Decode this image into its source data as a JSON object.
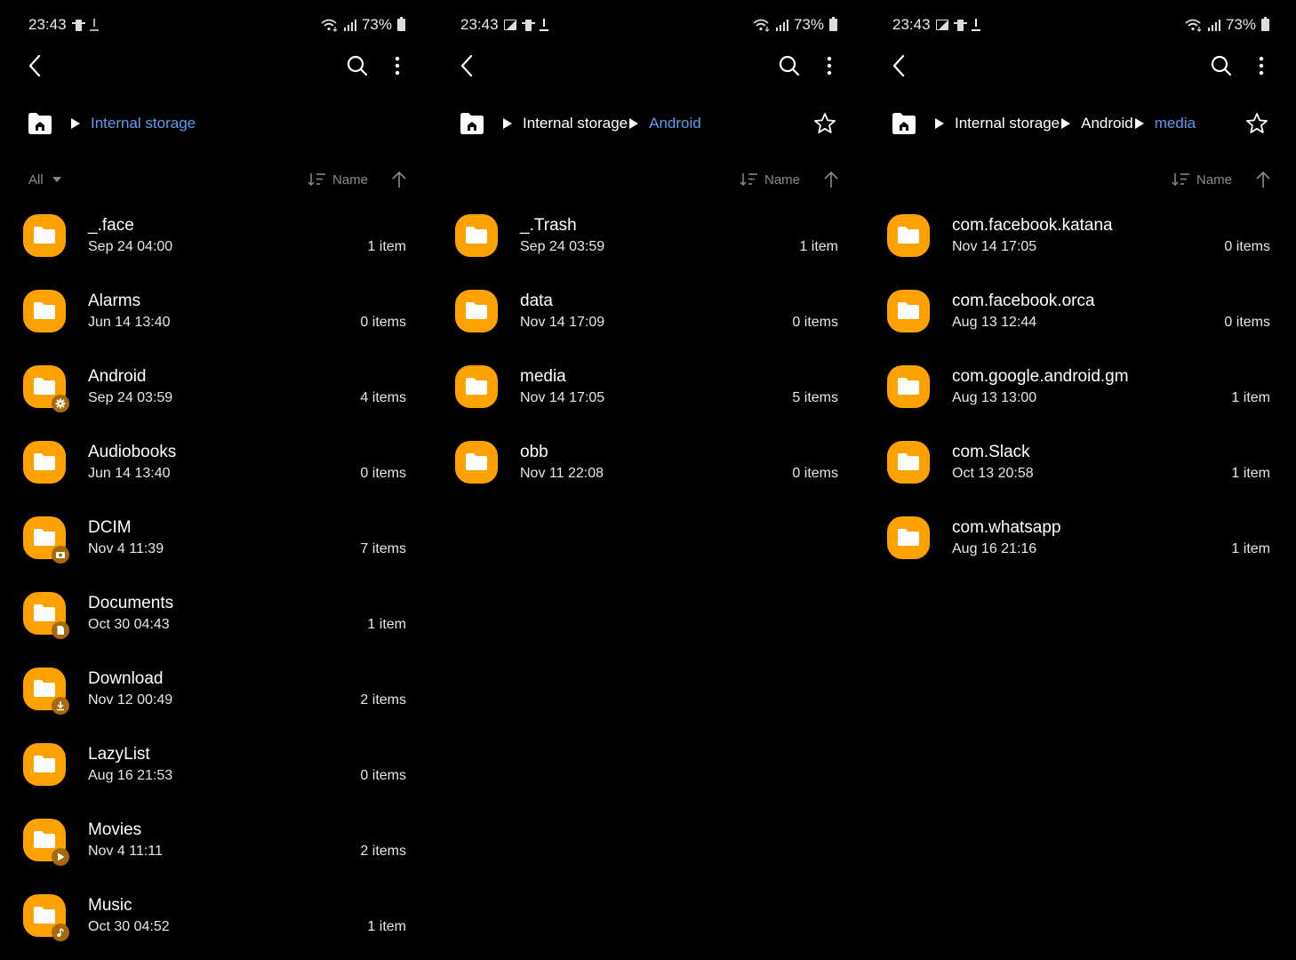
{
  "colors": {
    "accent": "#5e9cf0",
    "folder": "#ffa200",
    "badge": "#a8680c",
    "background": "#000000"
  },
  "panels": [
    {
      "status": {
        "time": "23:43",
        "icons_left": [
          "phone-mirror-icon",
          "download-icon"
        ],
        "battery": "73%"
      },
      "breadcrumb": [
        {
          "label": "Internal storage",
          "active": true
        }
      ],
      "has_star": false,
      "filter": {
        "label": "All"
      },
      "sort": {
        "label": "Name",
        "direction": "ascending"
      },
      "items": [
        {
          "name": "_.face",
          "date": "Sep 24 04:00",
          "count": "1 item",
          "badge": ""
        },
        {
          "name": "Alarms",
          "date": "Jun 14 13:40",
          "count": "0 items",
          "badge": ""
        },
        {
          "name": "Android",
          "date": "Sep 24 03:59",
          "count": "4 items",
          "badge": "gear"
        },
        {
          "name": "Audiobooks",
          "date": "Jun 14 13:40",
          "count": "0 items",
          "badge": ""
        },
        {
          "name": "DCIM",
          "date": "Nov 4 11:39",
          "count": "7 items",
          "badge": "camera"
        },
        {
          "name": "Documents",
          "date": "Oct 30 04:43",
          "count": "1 item",
          "badge": "document"
        },
        {
          "name": "Download",
          "date": "Nov 12 00:49",
          "count": "2 items",
          "badge": "download"
        },
        {
          "name": "LazyList",
          "date": "Aug 16 21:53",
          "count": "0 items",
          "badge": ""
        },
        {
          "name": "Movies",
          "date": "Nov 4 11:11",
          "count": "2 items",
          "badge": "play"
        },
        {
          "name": "Music",
          "date": "Oct 30 04:52",
          "count": "1 item",
          "badge": "music"
        }
      ]
    },
    {
      "status": {
        "time": "23:43",
        "icons_left": [
          "gallery-icon",
          "phone-mirror-icon",
          "download-icon"
        ],
        "battery": "73%"
      },
      "breadcrumb": [
        {
          "label": "Internal storage",
          "active": false
        },
        {
          "label": "Android",
          "active": true
        }
      ],
      "has_star": true,
      "filter": null,
      "sort": {
        "label": "Name",
        "direction": "ascending"
      },
      "items": [
        {
          "name": "_.Trash",
          "date": "Sep 24 03:59",
          "count": "1 item",
          "badge": ""
        },
        {
          "name": "data",
          "date": "Nov 14 17:09",
          "count": "0 items",
          "badge": ""
        },
        {
          "name": "media",
          "date": "Nov 14 17:05",
          "count": "5 items",
          "badge": ""
        },
        {
          "name": "obb",
          "date": "Nov 11 22:08",
          "count": "0 items",
          "badge": ""
        }
      ]
    },
    {
      "status": {
        "time": "23:43",
        "icons_left": [
          "gallery-icon",
          "phone-mirror-icon",
          "download-icon"
        ],
        "battery": "73%"
      },
      "breadcrumb": [
        {
          "label": "Internal storage",
          "active": false
        },
        {
          "label": "Android",
          "active": false
        },
        {
          "label": "media",
          "active": true
        }
      ],
      "has_star": true,
      "filter": null,
      "sort": {
        "label": "Name",
        "direction": "ascending"
      },
      "items": [
        {
          "name": "com.facebook.katana",
          "date": "Nov 14 17:05",
          "count": "0 items",
          "badge": ""
        },
        {
          "name": "com.facebook.orca",
          "date": "Aug 13 12:44",
          "count": "0 items",
          "badge": ""
        },
        {
          "name": "com.google.android.gm",
          "date": "Aug 13 13:00",
          "count": "1 item",
          "badge": ""
        },
        {
          "name": "com.Slack",
          "date": "Oct 13 20:58",
          "count": "1 item",
          "badge": ""
        },
        {
          "name": "com.whatsapp",
          "date": "Aug 16 21:16",
          "count": "1 item",
          "badge": ""
        }
      ]
    }
  ]
}
